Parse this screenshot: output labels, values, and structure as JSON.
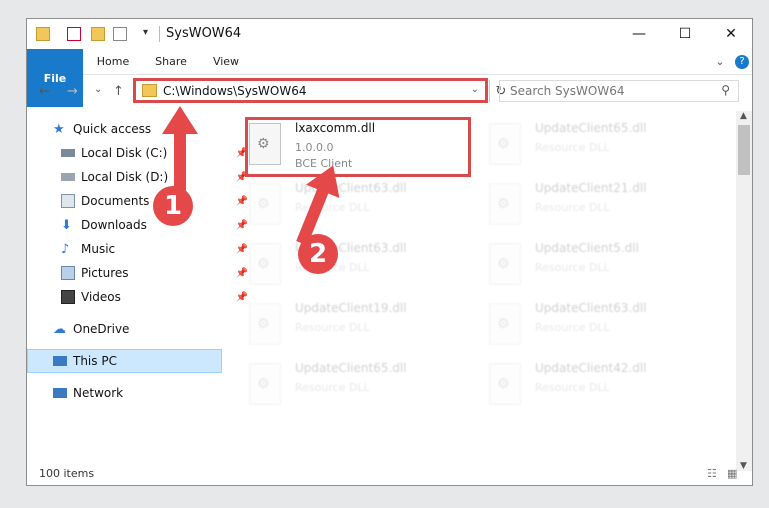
{
  "window": {
    "title": "SysWOW64"
  },
  "controls": {
    "minimize": "—",
    "maximize": "☐",
    "close": "✕"
  },
  "ribbon": {
    "file": "File",
    "home": "Home",
    "share": "Share",
    "view": "View"
  },
  "address": {
    "path": "C:\\Windows\\SysWOW64"
  },
  "search": {
    "placeholder": "Search SysWOW64"
  },
  "sidebar": {
    "items": [
      {
        "label": "Quick access"
      },
      {
        "label": "Local Disk (C:)"
      },
      {
        "label": "Local Disk (D:)"
      },
      {
        "label": "Documents"
      },
      {
        "label": "Downloads"
      },
      {
        "label": "Music"
      },
      {
        "label": "Pictures"
      },
      {
        "label": "Videos"
      },
      {
        "label": "OneDrive"
      },
      {
        "label": "This PC"
      },
      {
        "label": "Network"
      }
    ]
  },
  "files": [
    {
      "name": "lxaxcomm.dll",
      "version": "1.0.0.0",
      "description": "BCE Client"
    },
    {
      "name": "UpdateClient65.dll",
      "version": "",
      "description": "Resource DLL"
    },
    {
      "name": "UpdateClient63.dll",
      "version": "",
      "description": "Resource DLL"
    },
    {
      "name": "UpdateClient21.dll",
      "version": "",
      "description": "Resource DLL"
    },
    {
      "name": "UpdateClient63.dll",
      "version": "",
      "description": "Resource DLL"
    },
    {
      "name": "UpdateClient5.dll",
      "version": "",
      "description": "Resource DLL"
    },
    {
      "name": "UpdateClient19.dll",
      "version": "",
      "description": "Resource DLL"
    },
    {
      "name": "UpdateClient63.dll",
      "version": "",
      "description": "Resource DLL"
    },
    {
      "name": "UpdateClient65.dll",
      "version": "",
      "description": "Resource DLL"
    },
    {
      "name": "UpdateClient42.dll",
      "version": "",
      "description": "Resource DLL"
    }
  ],
  "status": {
    "count": "100 items"
  },
  "annotations": {
    "step1": "1",
    "step2": "2"
  },
  "colors": {
    "accent": "#1979ca",
    "annotation": "#e44848",
    "selected": "#cce8ff"
  }
}
